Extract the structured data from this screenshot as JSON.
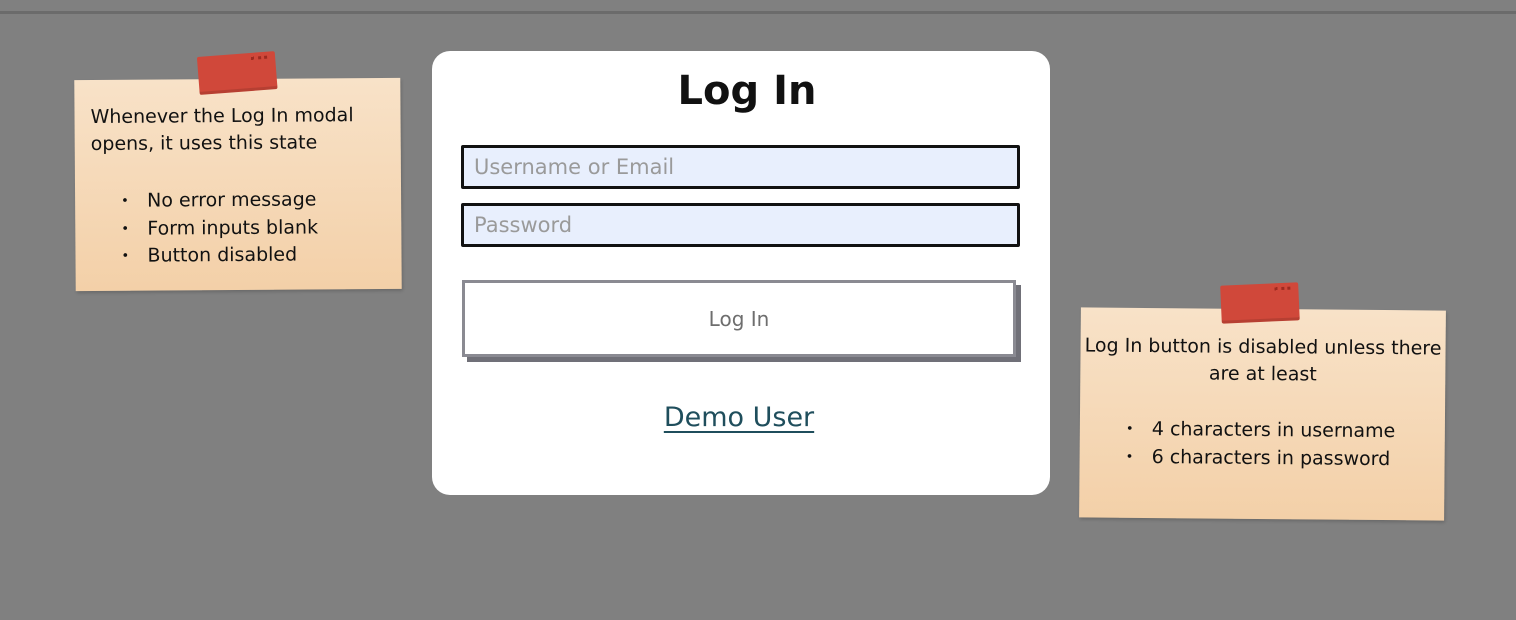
{
  "notes": {
    "left": {
      "text": "Whenever the Log In modal opens, it uses this state",
      "items": [
        "No error message",
        "Form inputs blank",
        "Button disabled"
      ]
    },
    "right": {
      "text": "Log In button is disabled unless there are at least",
      "items": [
        "4 characters in username",
        "6 characters in password"
      ]
    }
  },
  "modal": {
    "title": "Log In",
    "username_placeholder": "Username or Email",
    "username_value": "",
    "password_placeholder": "Password",
    "password_value": "",
    "login_button_label": "Log In",
    "login_button_disabled": true,
    "demo_link_label": "Demo User"
  },
  "colors": {
    "background": "#808080",
    "note": "#f3d0a8",
    "tape": "#d0483a",
    "input_fill": "#e8effd",
    "link": "#1f4e5c"
  }
}
